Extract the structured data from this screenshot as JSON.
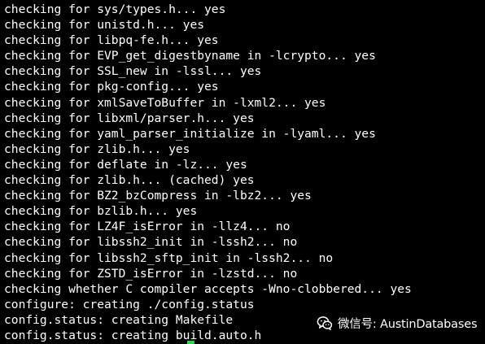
{
  "terminal": {
    "lines": [
      "checking for sys/types.h... yes",
      "checking for unistd.h... yes",
      "checking for libpq-fe.h... yes",
      "checking for EVP_get_digestbyname in -lcrypto... yes",
      "checking for SSL_new in -lssl... yes",
      "checking for pkg-config... yes",
      "checking for xmlSaveToBuffer in -lxml2... yes",
      "checking for libxml/parser.h... yes",
      "checking for yaml_parser_initialize in -lyaml... yes",
      "checking for zlib.h... yes",
      "checking for deflate in -lz... yes",
      "checking for zlib.h... (cached) yes",
      "checking for BZ2_bzCompress in -lbz2... yes",
      "checking for bzlib.h... yes",
      "checking for LZ4F_isError in -llz4... no",
      "checking for libssh2_init in -lssh2... no",
      "checking for libssh2_sftp_init in -lssh2... no",
      "checking for ZSTD_isError in -lzstd... no",
      "checking whether C compiler accepts -Wno-clobbered... yes",
      "configure: creating ./config.status",
      "config.status: creating Makefile",
      "config.status: creating build.auto.h"
    ],
    "colors": {
      "background": "#000000",
      "text": "#ffffff",
      "cursor": "#35d04a"
    }
  },
  "watermark": {
    "icon": "wechat-icon",
    "text": "微信号: AustinDatabases"
  }
}
